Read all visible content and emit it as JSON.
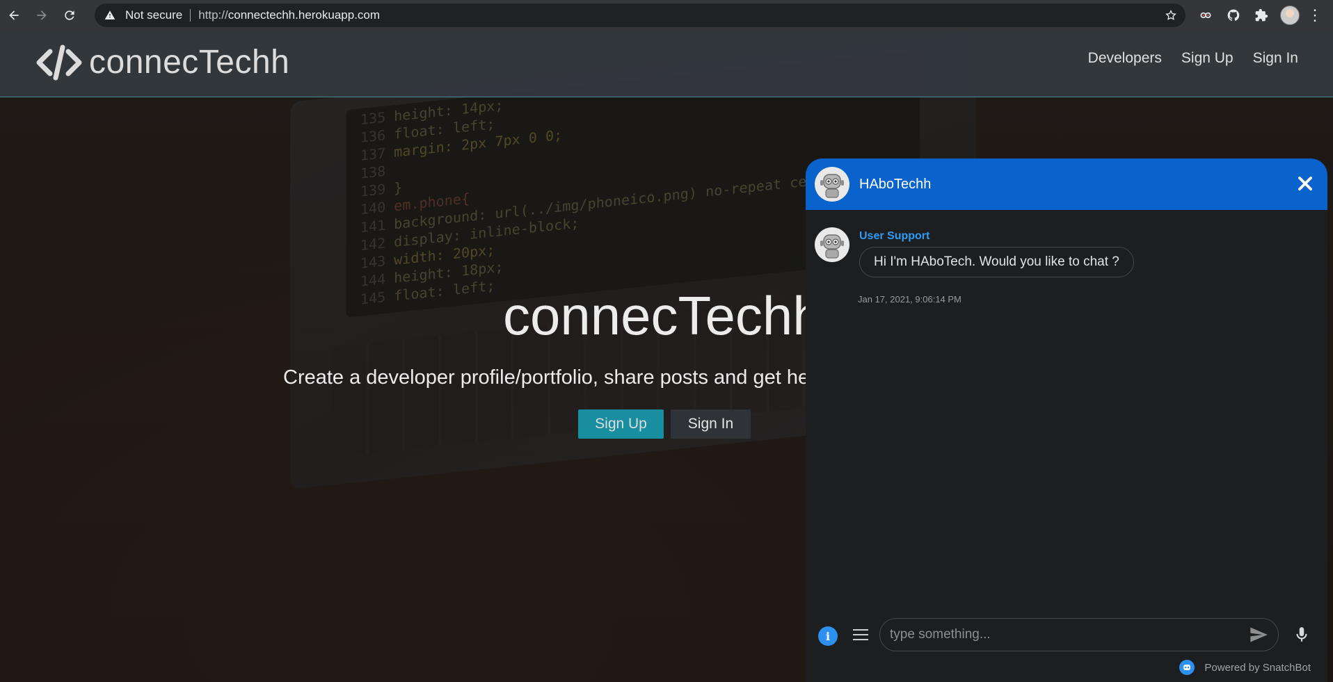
{
  "browser": {
    "security_label": "Not secure",
    "url_scheme": "http://",
    "url_host": "connectechh.herokuapp.com"
  },
  "site": {
    "brand": "connecTechh",
    "nav_links": [
      "Developers",
      "Sign Up",
      "Sign In"
    ]
  },
  "hero": {
    "title": "connecTechh",
    "subtitle": "Create a developer profile/portfolio, share posts and get help from other developers",
    "signup_label": "Sign Up",
    "signin_label": "Sign In"
  },
  "chat": {
    "title": "HAboTechh",
    "sender": "User Support",
    "message": "Hi I'm HAboTech. Would you like to chat ?",
    "timestamp": "Jan 17, 2021, 9:06:14 PM",
    "input_placeholder": "type something...",
    "powered_by": "Powered by SnatchBot",
    "header_color": "#0a63cc",
    "accent_color": "#2d9cf5"
  },
  "background_code": [
    {
      "ln": "135",
      "text": "height: 14px;"
    },
    {
      "ln": "136",
      "text": "float: left;"
    },
    {
      "ln": "137",
      "text": "margin: 2px 7px 0 0;"
    },
    {
      "ln": "138",
      "text": ""
    },
    {
      "ln": "139",
      "text": "}"
    },
    {
      "ln": "140",
      "text": "em.phone{"
    },
    {
      "ln": "141",
      "text": "background: url(../img/phoneico.png) no-repeat center;"
    },
    {
      "ln": "142",
      "text": "display: inline-block;"
    },
    {
      "ln": "143",
      "text": "width: 20px;"
    },
    {
      "ln": "144",
      "text": "height: 18px;"
    },
    {
      "ln": "145",
      "text": "float: left;"
    }
  ]
}
